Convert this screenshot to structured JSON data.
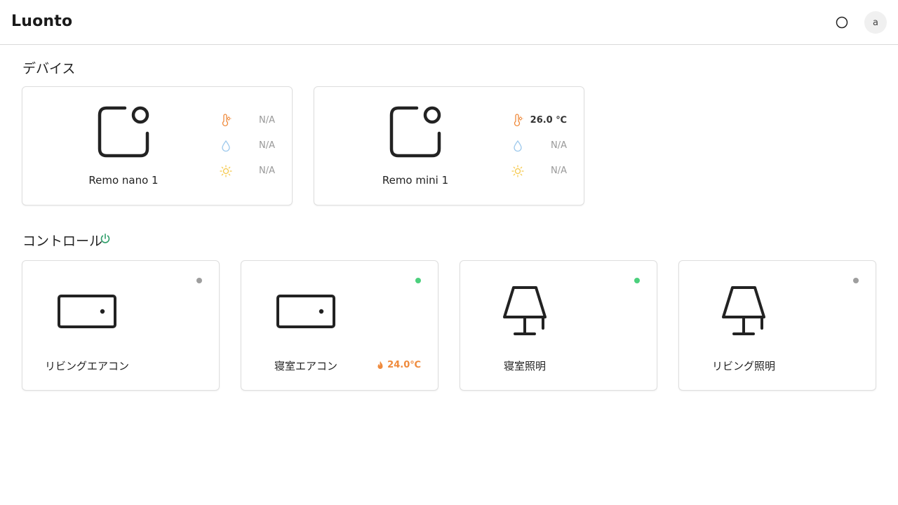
{
  "header": {
    "brand": "Luonto",
    "theme_icon": "circle-outline-icon",
    "avatar_initial": "a"
  },
  "devices_section": {
    "title": "デバイス",
    "devices": [
      {
        "name": "Remo nano 1",
        "icon": "remo-device-icon",
        "sensors": [
          {
            "type": "temperature",
            "icon": "thermometer-icon",
            "value": "N/A"
          },
          {
            "type": "humidity",
            "icon": "droplet-icon",
            "value": "N/A"
          },
          {
            "type": "illuminance",
            "icon": "sun-icon",
            "value": "N/A"
          }
        ]
      },
      {
        "name": "Remo mini 1",
        "icon": "remo-device-icon",
        "sensors": [
          {
            "type": "temperature",
            "icon": "thermometer-icon",
            "value": "26.0 ℃"
          },
          {
            "type": "humidity",
            "icon": "droplet-icon",
            "value": "N/A"
          },
          {
            "type": "illuminance",
            "icon": "sun-icon",
            "value": "N/A"
          }
        ]
      }
    ]
  },
  "controls_section": {
    "title": "コントロール",
    "power_icon": "power-icon",
    "controls": [
      {
        "name": "リビングエアコン",
        "type": "aircon",
        "status": "off",
        "temperature": ""
      },
      {
        "name": "寝室エアコン",
        "type": "aircon",
        "status": "on",
        "temperature": "24.0℃"
      },
      {
        "name": "寝室照明",
        "type": "light",
        "status": "on",
        "temperature": ""
      },
      {
        "name": "リビング照明",
        "type": "light",
        "status": "off",
        "temperature": ""
      }
    ]
  },
  "colors": {
    "status_on": "#4cd07d",
    "status_off": "#9e9e9e",
    "heat": "#ef8a3c",
    "power": "#2e9e6a",
    "temperature_icon": "#ef8a3c",
    "humidity_icon": "#9cc8ec",
    "illuminance_icon": "#f5c84a"
  }
}
